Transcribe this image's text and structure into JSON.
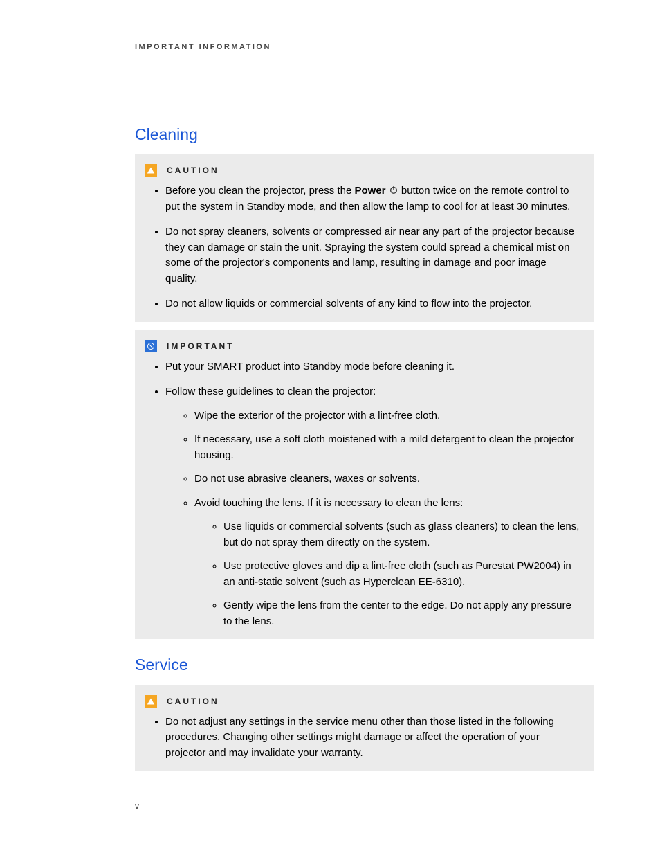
{
  "header": "IMPORTANT INFORMATION",
  "sections": {
    "cleaning": {
      "title": "Cleaning",
      "caution": {
        "label": "CAUTION",
        "items": [
          {
            "pre": "Before you clean the projector, press the ",
            "power_word": "Power",
            "post": " button twice on the remote control to put the system in Standby mode, and then allow the lamp to cool for at least 30 minutes."
          },
          {
            "text": "Do not spray cleaners, solvents or compressed air near any part of the projector because they can damage or stain the unit. Spraying the system could spread a chemical mist on some of the projector's components and lamp, resulting in damage and poor image quality."
          },
          {
            "text": "Do not allow liquids or commercial solvents of any kind to flow into the projector."
          }
        ]
      },
      "important": {
        "label": "IMPORTANT",
        "items": [
          {
            "text": "Put your SMART product into Standby mode before cleaning it."
          },
          {
            "text": "Follow these guidelines to clean the projector:",
            "sub": [
              {
                "text": "Wipe the exterior of the projector with a lint-free cloth."
              },
              {
                "text": "If necessary, use a soft cloth moistened with a mild detergent to clean the projector housing."
              },
              {
                "text": "Do not use abrasive cleaners, waxes or solvents."
              },
              {
                "text": "Avoid touching the lens. If it is necessary to clean the lens:",
                "sub": [
                  {
                    "text": "Use liquids or commercial solvents (such as glass cleaners) to clean the lens, but do not spray them directly on the system."
                  },
                  {
                    "text": "Use protective gloves and dip a lint-free cloth (such as Purestat PW2004) in an anti-static solvent (such as Hyperclean EE-6310)."
                  },
                  {
                    "text": "Gently wipe the lens from the center to the edge. Do not apply any pressure to the lens."
                  }
                ]
              }
            ]
          }
        ]
      }
    },
    "service": {
      "title": "Service",
      "caution": {
        "label": "CAUTION",
        "items": [
          {
            "text": "Do not adjust any settings in the service menu other than those listed in the following procedures. Changing other settings might damage or affect the operation of your projector and may invalidate your warranty."
          }
        ]
      }
    }
  },
  "page_number": "v"
}
